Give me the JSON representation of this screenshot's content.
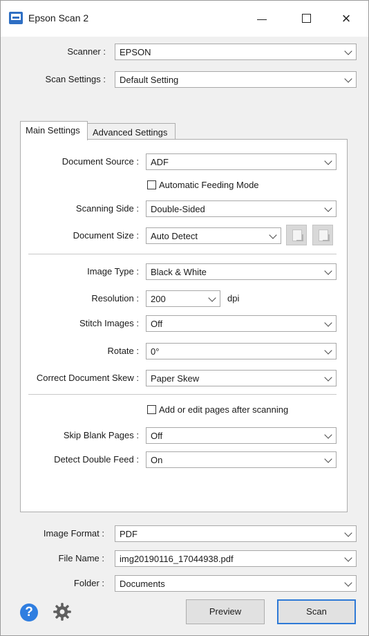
{
  "window": {
    "title": "Epson Scan 2"
  },
  "top": {
    "scanner_label": "Scanner :",
    "scanner_value": "EPSON",
    "scan_settings_label": "Scan Settings :",
    "scan_settings_value": "Default Setting"
  },
  "tabs": [
    {
      "label": "Main Settings",
      "active": true
    },
    {
      "label": "Advanced Settings",
      "active": false
    }
  ],
  "main": {
    "document_source_label": "Document Source :",
    "document_source_value": "ADF",
    "auto_feed_label": "Automatic Feeding Mode",
    "scanning_side_label": "Scanning Side :",
    "scanning_side_value": "Double-Sided",
    "document_size_label": "Document Size :",
    "document_size_value": "Auto Detect",
    "image_type_label": "Image Type :",
    "image_type_value": "Black & White",
    "resolution_label": "Resolution :",
    "resolution_value": "200",
    "resolution_unit": "dpi",
    "stitch_label": "Stitch Images :",
    "stitch_value": "Off",
    "rotate_label": "Rotate :",
    "rotate_value": "0°",
    "skew_label": "Correct Document Skew :",
    "skew_value": "Paper Skew",
    "add_edit_label": "Add or edit pages after scanning",
    "skip_blank_label": "Skip Blank Pages :",
    "skip_blank_value": "Off",
    "double_feed_label": "Detect Double Feed :",
    "double_feed_value": "On"
  },
  "bottom": {
    "image_format_label": "Image Format :",
    "image_format_value": "PDF",
    "file_name_label": "File Name :",
    "file_name_value": "img20190116_17044938.pdf",
    "folder_label": "Folder :",
    "folder_value": "Documents"
  },
  "buttons": {
    "preview": "Preview",
    "scan": "Scan",
    "help": "?"
  },
  "colors": {
    "accent": "#2e79d6",
    "help_icon": "#2f7ee0"
  }
}
